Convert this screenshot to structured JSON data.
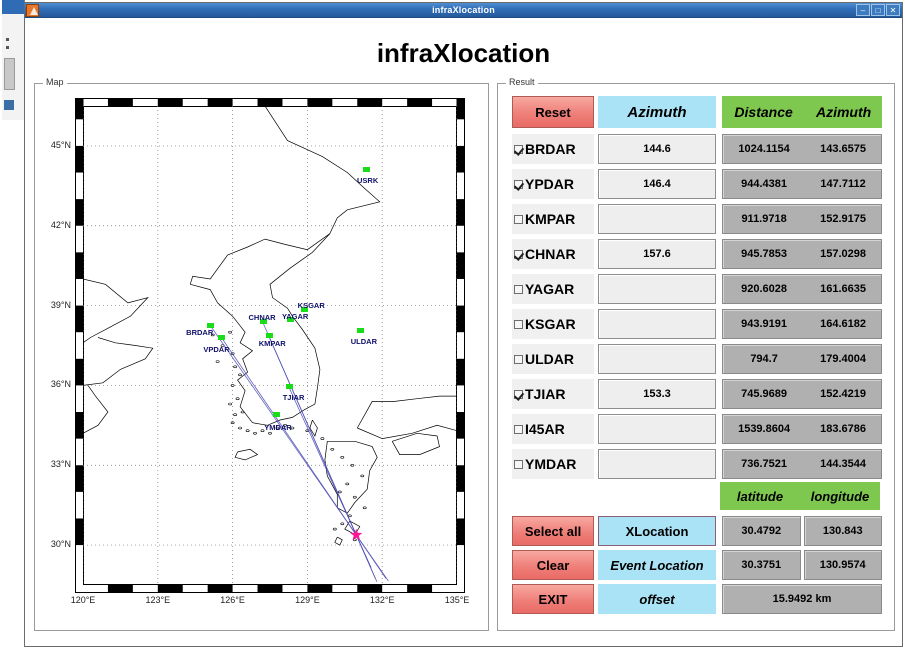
{
  "window": {
    "title": "infraXlocation",
    "icon": "app-icon",
    "buttons": {
      "minimize": "–",
      "maximize": "□",
      "close": "✕"
    }
  },
  "page_title": "infraXlocation",
  "panels": {
    "map_label": "Map",
    "result_label": "Result"
  },
  "map": {
    "xaxis": {
      "ticks": [
        "120°E",
        "123°E",
        "126°E",
        "129°E",
        "132°E",
        "135°E"
      ],
      "min": 120,
      "max": 135
    },
    "yaxis": {
      "ticks": [
        "45°N",
        "42°N",
        "39°N",
        "36°N",
        "33°N",
        "30°N"
      ],
      "min": 28.5,
      "max": 46.5
    },
    "stations": [
      {
        "name": "USRK",
        "lon": 131.35,
        "lat": 44.1
      },
      {
        "name": "BRDAR",
        "lon": 125.1,
        "lat": 38.25
      },
      {
        "name": "VPDAR",
        "lon": 125.55,
        "lat": 37.8
      },
      {
        "name": "CHNAR",
        "lon": 127.2,
        "lat": 38.4
      },
      {
        "name": "KMPAR",
        "lon": 127.45,
        "lat": 37.85
      },
      {
        "name": "KSGAR",
        "lon": 128.85,
        "lat": 38.85
      },
      {
        "name": "YAGAR",
        "lon": 128.3,
        "lat": 38.45
      },
      {
        "name": "ULDAR",
        "lon": 131.1,
        "lat": 38.05
      },
      {
        "name": "TJIAR",
        "lon": 128.25,
        "lat": 35.95
      },
      {
        "name": "YMDAR",
        "lon": 127.75,
        "lat": 34.9
      }
    ],
    "event_marker": {
      "symbol": "star",
      "lon": 130.96,
      "lat": 30.38,
      "color": "#ff1493"
    },
    "bearing_line_color": "#4a4ab4",
    "station_marker_color": "#19dd19",
    "station_label_color": "#10106b"
  },
  "result": {
    "header": {
      "reset_label": "Reset",
      "azimuth_input_label": "Azimuth",
      "distance_label": "Distance",
      "azimuth_calc_label": "Azimuth"
    },
    "rows": [
      {
        "name": "BRDAR",
        "checked": true,
        "azimuth": "144.6",
        "distance": "1024.1154",
        "calc_azimuth": "143.6575"
      },
      {
        "name": "YPDAR",
        "checked": true,
        "azimuth": "146.4",
        "distance": "944.4381",
        "calc_azimuth": "147.7112"
      },
      {
        "name": "KMPAR",
        "checked": false,
        "azimuth": "",
        "distance": "911.9718",
        "calc_azimuth": "152.9175"
      },
      {
        "name": "CHNAR",
        "checked": true,
        "azimuth": "157.6",
        "distance": "945.7853",
        "calc_azimuth": "157.0298"
      },
      {
        "name": "YAGAR",
        "checked": false,
        "azimuth": "",
        "distance": "920.6028",
        "calc_azimuth": "161.6635"
      },
      {
        "name": "KSGAR",
        "checked": false,
        "azimuth": "",
        "distance": "943.9191",
        "calc_azimuth": "164.6182"
      },
      {
        "name": "ULDAR",
        "checked": false,
        "azimuth": "",
        "distance": "794.7",
        "calc_azimuth": "179.4004"
      },
      {
        "name": "TJIAR",
        "checked": true,
        "azimuth": "153.3",
        "distance": "745.9689",
        "calc_azimuth": "152.4219"
      },
      {
        "name": "I45AR",
        "checked": false,
        "azimuth": "",
        "distance": "1539.8604",
        "calc_azimuth": "183.6786"
      },
      {
        "name": "YMDAR",
        "checked": false,
        "azimuth": "",
        "distance": "736.7521",
        "calc_azimuth": "144.3544"
      }
    ],
    "latlon_header": {
      "latitude": "latitude",
      "longitude": "longitude"
    },
    "bottom": {
      "select_all_label": "Select all",
      "clear_label": "Clear",
      "exit_label": "EXIT",
      "xlocation_label": "XLocation",
      "event_location_label": "Event Location",
      "offset_label": "offset",
      "xlocation_lat": "30.4792",
      "xlocation_lon": "130.843",
      "event_lat": "30.3751",
      "event_lon": "130.9574",
      "offset_value": "15.9492  km"
    }
  },
  "colors": {
    "red_button": "#ef7f79",
    "cyan_header": "#a9e3f5",
    "green_header": "#7ec850",
    "value_gray": "#b0b0b0",
    "input_gray": "#eeeeee",
    "titlebar_blue": "#2f6cb5"
  }
}
